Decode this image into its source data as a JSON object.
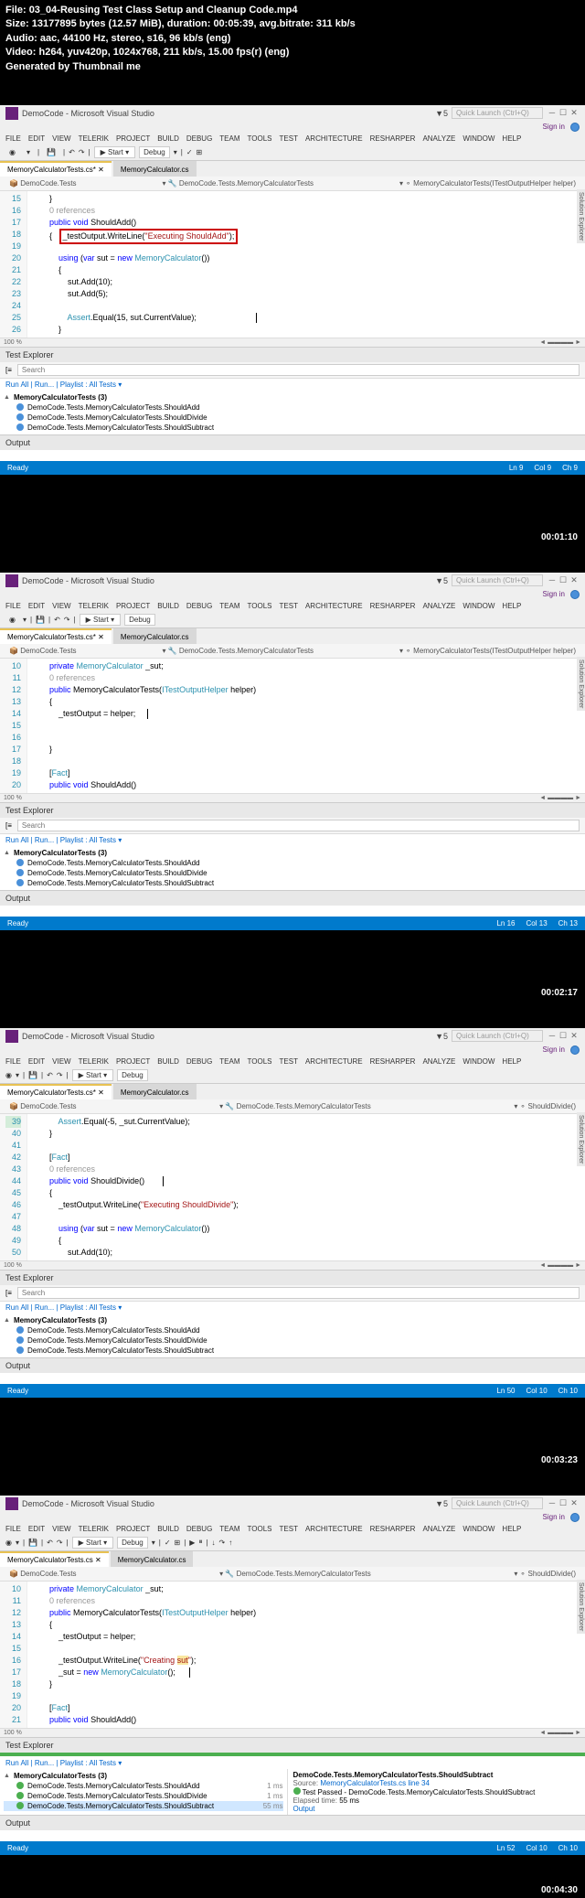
{
  "fileinfo": {
    "file_label": "File:",
    "file": "03_04-Reusing Test Class Setup and Cleanup Code.mp4",
    "size_label": "Size:",
    "size": "13177895 bytes (12.57 MiB), duration: 00:05:39, avg.bitrate: 311 kb/s",
    "audio_label": "Audio:",
    "audio": "aac, 44100 Hz, stereo, s16, 96 kb/s (eng)",
    "video_label": "Video:",
    "video": "h264, yuv420p, 1024x768, 211 kb/s, 15.00 fps(r) (eng)",
    "gen": "Generated by Thumbnail me"
  },
  "timestamps": [
    "00:01:10",
    "00:02:17",
    "00:03:23",
    "00:04:30"
  ],
  "vs": {
    "title": "DemoCode - Microsoft Visual Studio",
    "quicklaunch": "Quick Launch (Ctrl+Q)",
    "signin": "Sign in",
    "menu": [
      "FILE",
      "EDIT",
      "VIEW",
      "TELERIK",
      "PROJECT",
      "BUILD",
      "DEBUG",
      "TEAM",
      "TOOLS",
      "TEST",
      "ARCHITECTURE",
      "RESHARPER",
      "ANALYZE",
      "WINDOW",
      "HELP"
    ],
    "start": "Start",
    "debug": "Debug",
    "tabs": {
      "active": "MemoryCalculatorTests.cs*",
      "inactive": "MemoryCalculator.cs",
      "active2": "MemoryCalculatorTests.cs"
    },
    "breadcrumb": {
      "project": "DemoCode.Tests",
      "ns1": "DemoCode.Tests.MemoryCalculatorTests",
      "m1": "MemoryCalculatorTests(ITestOutputHelper helper)",
      "m2": "ShouldDivide()"
    },
    "solution_explorer": "Solution Explorer",
    "zoom": "100 %",
    "test_explorer": "Test Explorer",
    "search_ph": "Search",
    "run_all": "Run All",
    "run": "Run...",
    "playlist": "Playlist : All Tests",
    "output": "Output",
    "ready": "Ready"
  },
  "shot1": {
    "lines": [
      "15",
      "16",
      "17",
      "18",
      "19",
      "20",
      "21",
      "22",
      "23",
      "24",
      "25",
      "26"
    ],
    "bc_method": "MemoryCalculatorTests(ITestOutputHelper helper)",
    "test_group": "MemoryCalculatorTests (3)",
    "tests": [
      "DemoCode.Tests.MemoryCalculatorTests.ShouldAdd",
      "DemoCode.Tests.MemoryCalculatorTests.ShouldDivide",
      "DemoCode.Tests.MemoryCalculatorTests.ShouldSubtract"
    ],
    "status": {
      "ln": "Ln 9",
      "col": "Col 9",
      "ch": "Ch 9"
    }
  },
  "shot2": {
    "lines": [
      "10",
      "11",
      "12",
      "13",
      "14",
      "15",
      "16",
      "17",
      "18",
      "19",
      "20"
    ],
    "status": {
      "ln": "Ln 16",
      "col": "Col 13",
      "ch": "Ch 13"
    }
  },
  "shot3": {
    "lines": [
      "39",
      "40",
      "41",
      "42",
      "43",
      "44",
      "45",
      "46",
      "47",
      "48",
      "49",
      "50"
    ],
    "status": {
      "ln": "Ln 50",
      "col": "Col 10",
      "ch": "Ch 10"
    }
  },
  "shot4": {
    "lines": [
      "10",
      "11",
      "12",
      "13",
      "14",
      "15",
      "16",
      "17",
      "18",
      "19",
      "20",
      "21"
    ],
    "status": {
      "ln": "Ln 52",
      "col": "Col 10",
      "ch": "Ch 10"
    },
    "test_group": "MemoryCalculatorTests (3)",
    "tests": [
      {
        "name": "DemoCode.Tests.MemoryCalculatorTests.ShouldAdd",
        "time": "1 ms"
      },
      {
        "name": "DemoCode.Tests.MemoryCalculatorTests.ShouldDivide",
        "time": "1 ms"
      },
      {
        "name": "DemoCode.Tests.MemoryCalculatorTests.ShouldSubtract",
        "time": "55 ms"
      }
    ],
    "detail": {
      "title": "DemoCode.Tests.MemoryCalculatorTests.ShouldSubtract",
      "source_label": "Source:",
      "source": "MemoryCalculatorTests.cs line 34",
      "passed": "Test Passed - DemoCode.Tests.MemoryCalculatorTests.ShouldSubtract",
      "elapsed_label": "Elapsed time:",
      "elapsed": "55 ms",
      "output": "Output"
    }
  }
}
